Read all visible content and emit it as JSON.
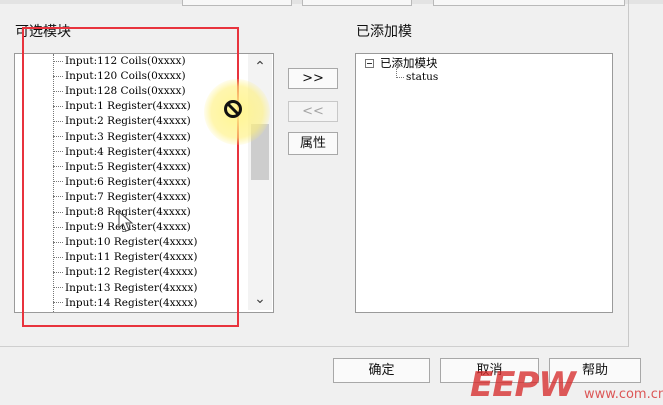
{
  "available_panel": {
    "label": "可选模块",
    "items": [
      "Input:112 Coils(0xxxx)",
      "Input:120 Coils(0xxxx)",
      "Input:128 Coils(0xxxx)",
      "Input:1 Register(4xxxx)",
      "Input:2 Register(4xxxx)",
      "Input:3 Register(4xxxx)",
      "Input:4 Register(4xxxx)",
      "Input:5 Register(4xxxx)",
      "Input:6 Register(4xxxx)",
      "Input:7 Register(4xxxx)",
      "Input:8 Register(4xxxx)",
      "Input:9 Register(4xxxx)",
      "Input:10 Register(4xxxx)",
      "Input:11 Register(4xxxx)",
      "Input:12 Register(4xxxx)",
      "Input:13 Register(4xxxx)",
      "Input:14 Register(4xxxx)"
    ],
    "scroll_up_glyph": "⌃",
    "scroll_down_glyph": "⌄"
  },
  "middle_buttons": {
    "add_label": ">>",
    "remove_label": "<<",
    "properties_label": "属性"
  },
  "added_panel": {
    "label": "已添加模",
    "root_node": "已添加模块",
    "child_node": "status"
  },
  "footer": {
    "ok_label": "确定",
    "cancel_label": "取消",
    "help_label": "帮助"
  },
  "watermark": {
    "brand": "EEPW",
    "domain": "www.com.cn"
  },
  "colors": {
    "highlight_box": "#e8333d",
    "watermark": "#d62c2c"
  },
  "icons": {
    "no_cursor": "no-entry-cursor-icon",
    "pointer": "arrow-cursor-icon"
  }
}
